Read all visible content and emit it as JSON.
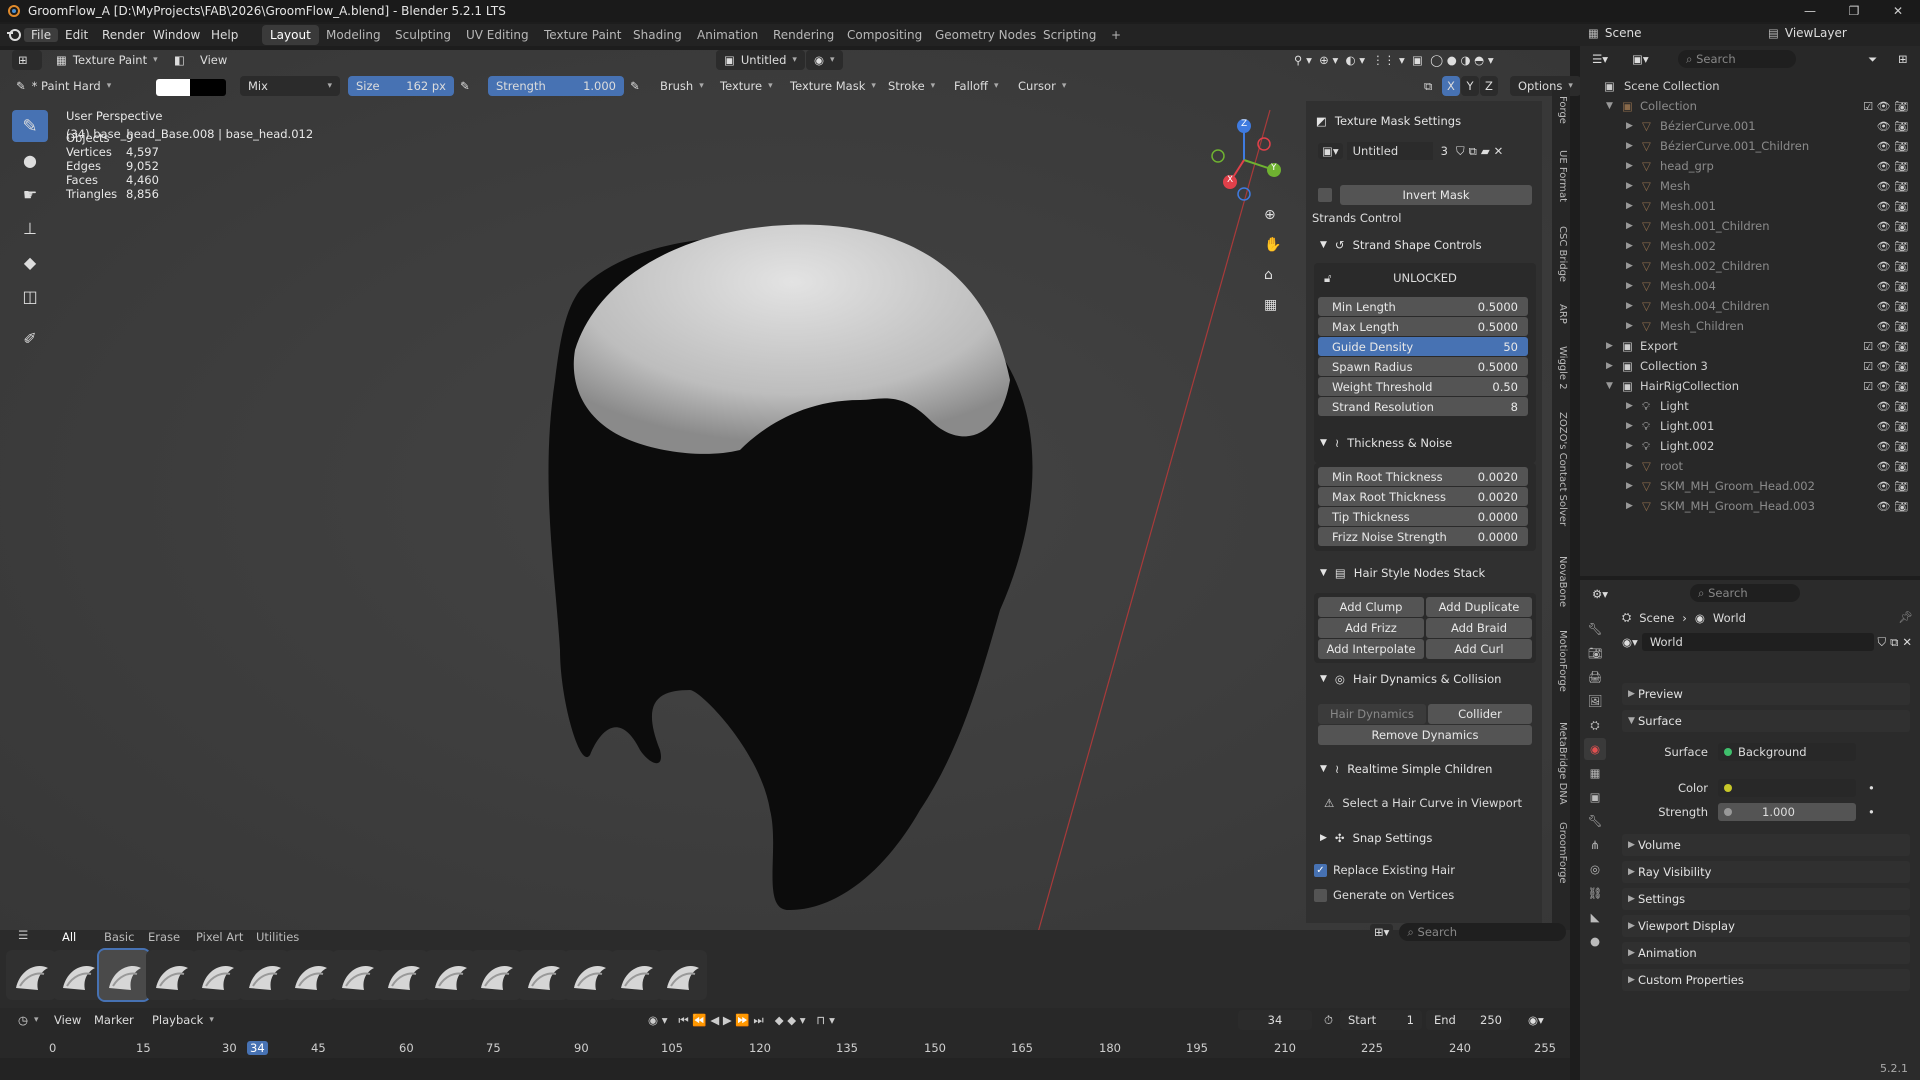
{
  "window": {
    "title": "GroomFlow_A [D:\\MyProjects\\FAB\\2026\\GroomFlow_A.blend] - Blender 5.2.1 LTS",
    "min": "—",
    "max": "❐",
    "close": "✕"
  },
  "menus": [
    "File",
    "Edit",
    "Render",
    "Window",
    "Help"
  ],
  "workspaces": [
    "Layout",
    "Modeling",
    "Sculpting",
    "UV Editing",
    "Texture Paint",
    "Shading",
    "Animation",
    "Rendering",
    "Compositing",
    "Geometry Nodes",
    "Scripting"
  ],
  "workspace_add": "+",
  "scene_selector": {
    "label": "Scene",
    "view_layer": "ViewLayer"
  },
  "viewport_header": {
    "mode": "Texture Paint",
    "view": "View",
    "image": "Untitled"
  },
  "tool_header": {
    "brush": "* Paint Hard",
    "blend": "Mix",
    "size_label": "Size",
    "size_value": "162 px",
    "strength_label": "Strength",
    "strength_value": "1.000",
    "brush_menu": "Brush",
    "texture": "Texture",
    "texture_mask": "Texture Mask",
    "stroke": "Stroke",
    "falloff": "Falloff",
    "cursor": "Cursor",
    "x": "X",
    "y": "Y",
    "z": "Z",
    "options": "Options"
  },
  "overlay": {
    "perspective": "User Perspective",
    "object": "(34) base_head_Base.008 | base_head.012",
    "stats": [
      {
        "k": "Objects",
        "v": "9"
      },
      {
        "k": "Vertices",
        "v": "4,597"
      },
      {
        "k": "Edges",
        "v": "9,052"
      },
      {
        "k": "Faces",
        "v": "4,460"
      },
      {
        "k": "Triangles",
        "v": "8,856"
      }
    ]
  },
  "gizmo": {
    "x": "X",
    "y": "Y",
    "z": "Z"
  },
  "npanel": {
    "texture_mask_settings": "Texture Mask Settings",
    "image_name": "Untitled",
    "image_users": "3",
    "invert_mask": "Invert Mask",
    "strands_control": "Strands Control",
    "strand_shape_controls": "Strand Shape Controls",
    "unlocked": "UNLOCKED",
    "shape_fields": [
      {
        "k": "Min Length",
        "v": "0.5000"
      },
      {
        "k": "Max Length",
        "v": "0.5000"
      },
      {
        "k": "Guide Density",
        "v": "50"
      },
      {
        "k": "Spawn Radius",
        "v": "0.5000"
      },
      {
        "k": "Weight Threshold",
        "v": "0.50"
      },
      {
        "k": "Strand Resolution",
        "v": "8"
      }
    ],
    "thickness_noise": "Thickness & Noise",
    "thickness_fields": [
      {
        "k": "Min Root Thickness",
        "v": "0.0020"
      },
      {
        "k": "Max Root Thickness",
        "v": "0.0020"
      },
      {
        "k": "Tip Thickness",
        "v": "0.0000"
      },
      {
        "k": "Frizz Noise Strength",
        "v": "0.0000"
      }
    ],
    "hair_style_nodes": "Hair Style Nodes Stack",
    "node_buttons": [
      "Add Clump",
      "Add Duplicate",
      "Add Frizz",
      "Add Braid",
      "Add Interpolate",
      "Add Curl"
    ],
    "dynamics": "Hair Dynamics & Collision",
    "hair_dynamics": "Hair Dynamics",
    "collider": "Collider",
    "remove_dynamics": "Remove Dynamics",
    "realtime_children": "Realtime Simple Children",
    "select_hint": "Select a Hair Curve in Viewport",
    "snap_settings": "Snap Settings",
    "replace_existing": "Replace Existing Hair",
    "generate_vertices": "Generate on Vertices"
  },
  "side_tabs": [
    "Forge",
    "UE Format",
    "CSC Bridge",
    "ARP",
    "Wiggle 2",
    "ZOZO's Contact Solver",
    "NovaBone",
    "MotionForge",
    "MetaBridge DNA",
    "GroomForge"
  ],
  "shelf": {
    "tabs": [
      "All",
      "Basic",
      "Erase",
      "Pixel Art",
      "Utilities"
    ],
    "search": "Search"
  },
  "timeline": {
    "view": "View",
    "marker": "Marker",
    "playback": "Playback",
    "current": "34",
    "start_label": "Start",
    "start": "1",
    "end_label": "End",
    "end": "250",
    "ticks": [
      "0",
      "15",
      "30",
      "34",
      "45",
      "60",
      "75",
      "90",
      "105",
      "120",
      "135",
      "150",
      "165",
      "180",
      "195",
      "210",
      "225",
      "240",
      "255"
    ]
  },
  "outliner": {
    "search": "Search",
    "root": "Scene Collection",
    "rows": [
      {
        "name": "Collection",
        "indent": 0,
        "dim": true
      },
      {
        "name": "BézierCurve.001",
        "indent": 1,
        "dim": true
      },
      {
        "name": "BézierCurve.001_Children",
        "indent": 1,
        "dim": true
      },
      {
        "name": "head_grp",
        "indent": 1,
        "dim": true
      },
      {
        "name": "Mesh",
        "indent": 1,
        "dim": true
      },
      {
        "name": "Mesh.001",
        "indent": 1,
        "dim": true
      },
      {
        "name": "Mesh.001_Children",
        "indent": 1,
        "dim": true
      },
      {
        "name": "Mesh.002",
        "indent": 1,
        "dim": true
      },
      {
        "name": "Mesh.002_Children",
        "indent": 1,
        "dim": true
      },
      {
        "name": "Mesh.004",
        "indent": 1,
        "dim": true
      },
      {
        "name": "Mesh.004_Children",
        "indent": 1,
        "dim": true
      },
      {
        "name": "Mesh_Children",
        "indent": 1,
        "dim": true
      },
      {
        "name": "Export",
        "indent": 0,
        "dim": false
      },
      {
        "name": "Collection 3",
        "indent": 0,
        "dim": false
      },
      {
        "name": "HairRigCollection",
        "indent": 0,
        "dim": false
      },
      {
        "name": "Light",
        "indent": 1,
        "dim": false
      },
      {
        "name": "Light.001",
        "indent": 1,
        "dim": false
      },
      {
        "name": "Light.002",
        "indent": 1,
        "dim": false
      },
      {
        "name": "root",
        "indent": 1,
        "dim": true
      },
      {
        "name": "SKM_MH_Groom_Head.002",
        "indent": 1,
        "dim": true
      },
      {
        "name": "SKM_MH_Groom_Head.003",
        "indent": 1,
        "dim": true
      }
    ]
  },
  "properties": {
    "search": "Search",
    "breadcrumb": [
      "Scene",
      "World"
    ],
    "world_name": "World",
    "sections": [
      "Preview",
      "Surface",
      "Volume",
      "Ray Visibility",
      "Settings",
      "Viewport Display",
      "Animation",
      "Custom Properties"
    ],
    "surface_label": "Surface",
    "surface_value": "Background",
    "color_label": "Color",
    "strength_label": "Strength",
    "strength_value": "1.000"
  },
  "version": "5.2.1",
  "colors": {
    "accent": "#4772b3",
    "header": "#232323",
    "panel": "#303030"
  }
}
